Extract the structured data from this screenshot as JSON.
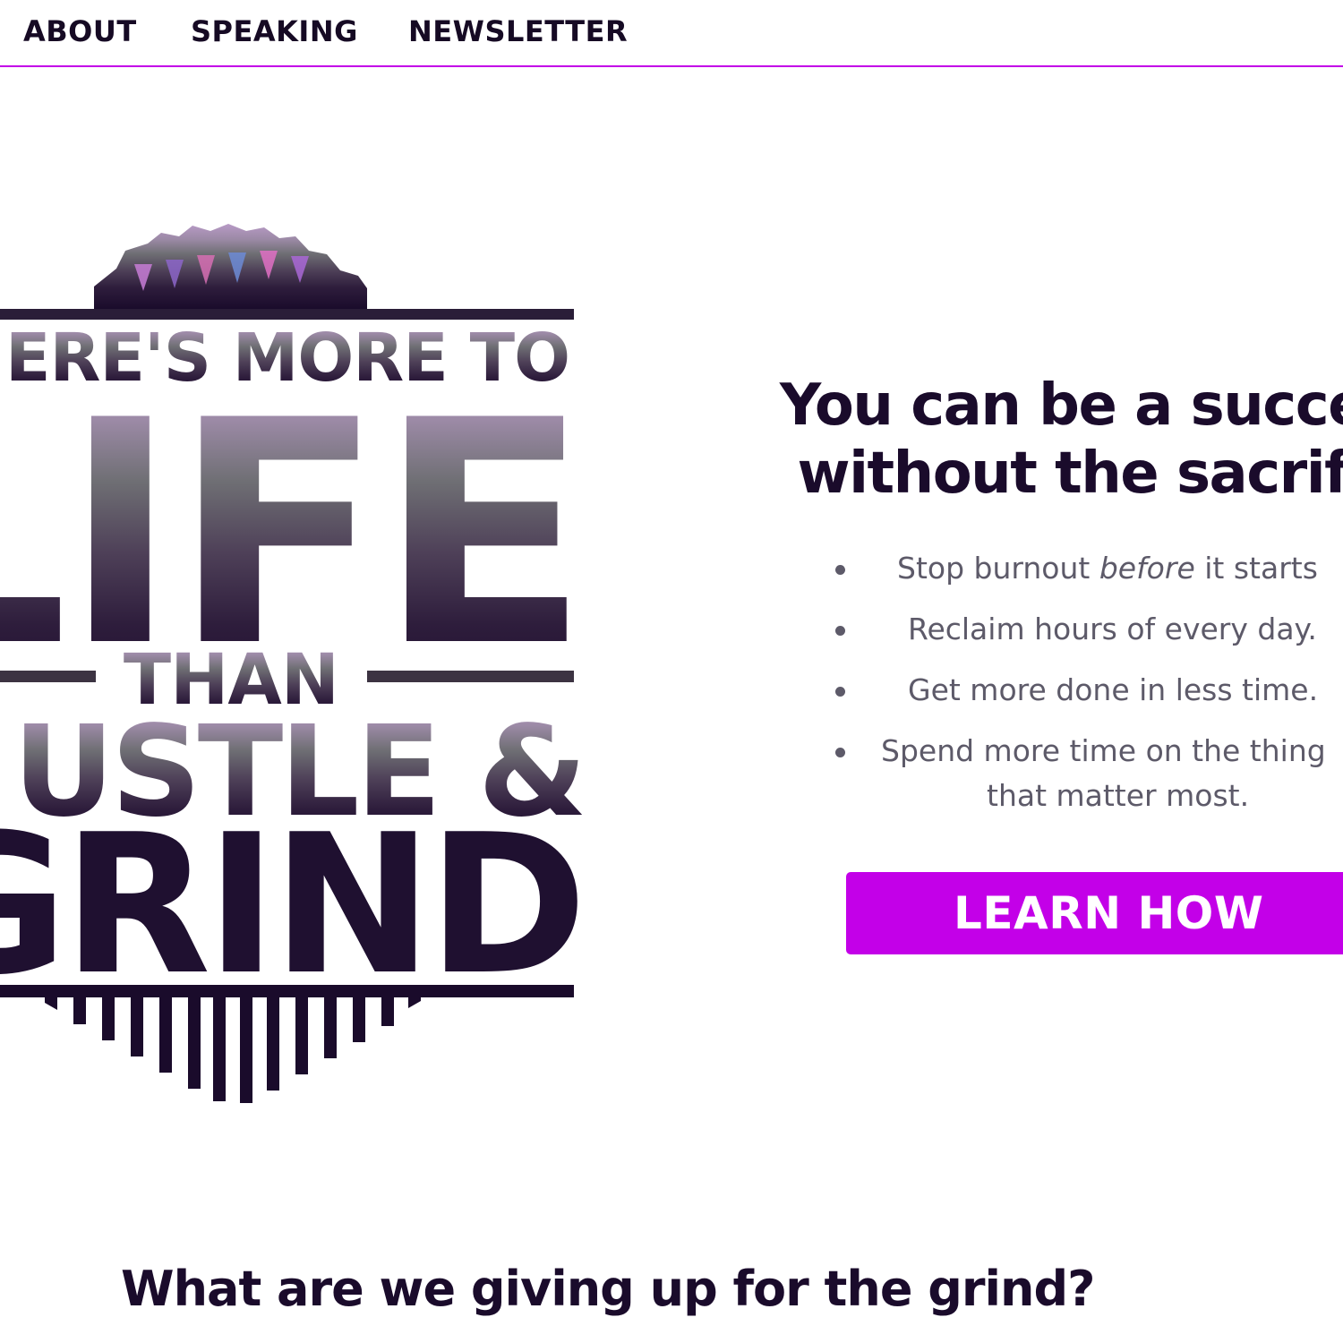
{
  "nav": {
    "items": [
      {
        "label": "ABOUT"
      },
      {
        "label": "SPEAKING"
      },
      {
        "label": "NEWSLETTER"
      }
    ]
  },
  "badge": {
    "line1": "ERE'S MORE TO",
    "line2": "LIFE",
    "line3": "THAN",
    "line4": "USTLE &",
    "line5": "GRIND"
  },
  "hero": {
    "headline_line1": "You can be a succe",
    "headline_line2": "without the sacrif",
    "benefits": [
      {
        "before": "Stop burnout ",
        "em": "before",
        "after": " it starts"
      },
      {
        "text": "Reclaim hours of every day."
      },
      {
        "text": "Get more done in less time."
      },
      {
        "line1": "Spend more time on the thing",
        "line2": "that matter most."
      }
    ],
    "cta_label": "LEARN HOW"
  },
  "section": {
    "heading": "What are we giving up for the grind?"
  },
  "colors": {
    "accent": "#c300e8",
    "ink": "#1a0b2b",
    "body_text": "#5d5a69"
  }
}
